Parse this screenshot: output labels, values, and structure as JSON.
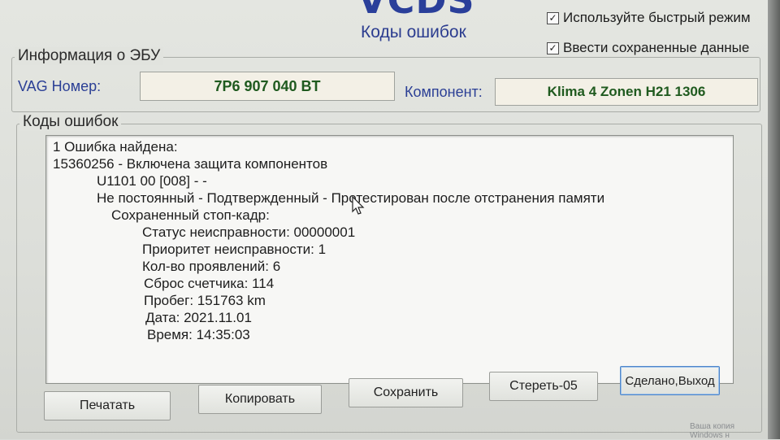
{
  "header": {
    "logo": "VCDS",
    "subtitle": "Коды ошибок"
  },
  "options": {
    "fast_mode": {
      "label": "Используйте быстрый режим",
      "checked": true
    },
    "saved_data": {
      "label": "Ввести сохраненные данные",
      "checked": true
    }
  },
  "ecu_info": {
    "title": "Информация о ЭБУ",
    "vag_label": "VAG Номер:",
    "vag_value": "7P6 907 040 BT",
    "component_label": "Компонент:",
    "component_value": "Klima 4 Zonen H21 1306"
  },
  "faults": {
    "title": "Коды ошибок",
    "lines": [
      "1 Ошибка найдена:",
      "15360256 - Включена защита компонентов",
      "U1101 00 [008] - -",
      "Не постоянный - Подтвержденный - Протестирован после отстранения памяти",
      "Сохраненный стоп-кадр:",
      "Статус неисправности: 00000001",
      "Приоритет неисправности: 1",
      "Кол-во проявлений: 6",
      "Сброс счетчика: 114",
      "Пробег: 151763 km",
      "Дата: 2021.11.01",
      "Время: 14:35:03"
    ]
  },
  "buttons": {
    "print": "Печатать",
    "copy": "Копировать",
    "save": "Сохранить",
    "clear": "Стереть-05",
    "done": "Сделано,Выход"
  },
  "watermark": "Ваша копия Windows н",
  "icons": {
    "checkbox": "check-mark",
    "cursor": "mouse-pointer-icon"
  },
  "colors": {
    "label_blue": "#2b3f95",
    "value_green": "#1f5a1f",
    "logo_blue": "#2a3f9a"
  }
}
